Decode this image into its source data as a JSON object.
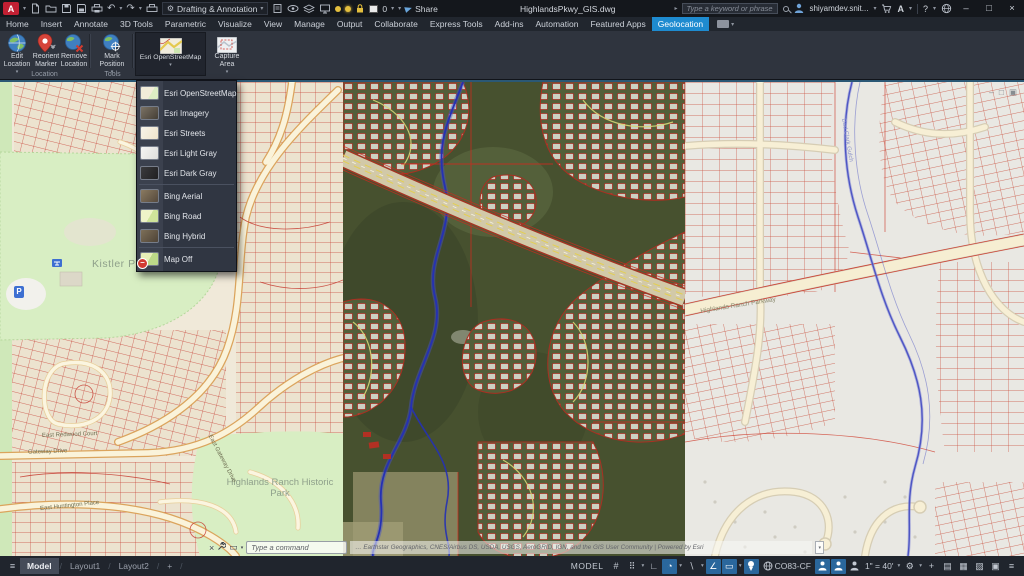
{
  "icons": {
    "caret_down": "▾",
    "caret_right": "▸",
    "menu": "≡",
    "minimize": "–",
    "maximize": "□",
    "restore": "▣",
    "close": "×",
    "undo": "↶",
    "redo": "↷",
    "slash": "/",
    "plus": "+",
    "grid_glyph": "#",
    "snap_glyph": "⠿",
    "ortho_glyph": "∟",
    "polar_glyph": "◔",
    "isodraft_glyph": "∖",
    "otrack_glyph": "∠",
    "osnap_glyph": "▭",
    "gear_glyph": "⚙",
    "help_glyph": "?",
    "panes_glyph": "▤",
    "perf_glyph": "▦",
    "lockui_glyph": "▨",
    "fullscreen_glyph": "▣"
  },
  "titlebar": {
    "logo_letter": "A",
    "workspace": "Drafting & Annotation",
    "doc_title": "HighlandsPkwy_GIS.dwg",
    "search_placeholder": "Type a keyword or phrase",
    "user_name": "shiyamdev.snit...",
    "share_label": "Share",
    "layer_value": "0"
  },
  "ribbon": {
    "tabs": [
      "Home",
      "Insert",
      "Annotate",
      "3D Tools",
      "Parametric",
      "Visualize",
      "View",
      "Manage",
      "Output",
      "Collaborate",
      "Express Tools",
      "Add-ins",
      "Automation",
      "Featured Apps",
      "Geolocation"
    ],
    "edit_location": {
      "l1": "Edit",
      "l2": "Location"
    },
    "reorient_marker": {
      "l1": "Reorient",
      "l2": "Marker"
    },
    "remove_location": {
      "l1": "Remove",
      "l2": "Location"
    },
    "mark_position": {
      "l1": "Mark",
      "l2": "Position"
    },
    "map_source_label": "Esri OpenStreetMap",
    "capture": {
      "l1": "Capture",
      "l2": "Area"
    },
    "groups": {
      "location": "Location",
      "tools": "Tools"
    }
  },
  "dropdown": {
    "items": [
      {
        "label": "Esri OpenStreetMap"
      },
      {
        "label": "Esri Imagery"
      },
      {
        "label": "Esri Streets"
      },
      {
        "label": "Esri Light Gray"
      },
      {
        "label": "Esri Dark Gray"
      },
      {
        "label": "Bing Aerial"
      },
      {
        "label": "Bing Road"
      },
      {
        "label": "Bing Hybrid"
      },
      {
        "label": "Map Off"
      }
    ]
  },
  "canvas": {
    "labels": {
      "kistler_park": "Kistler Park",
      "historic_park": "Highlands Ranch Historic Park",
      "gateway_drive": "Gateway Drive",
      "east_redwood_court": "East Redwood Court",
      "east_huntington_place": "East Huntington Place",
      "east_gateway_drive": "East Gateway Drive",
      "hr_parkway": "Highlands Ranch Parkway",
      "dad_clark": "Dad Clark Gulch",
      "parking": "P"
    }
  },
  "command": {
    "placeholder": "Type a command",
    "attribution": "… Earthstar Geographics, CNES/Airbus DS, USDA, USGS, AeroGRID, IGN, and the GIS User Community  |  Powered by Esri"
  },
  "statusbar": {
    "model_tab": "Model",
    "layout1": "Layout1",
    "layout2": "Layout2",
    "mode_label": "MODEL",
    "coord_system": "CO83-CF",
    "annotation_scale": "1\" = 40'"
  }
}
